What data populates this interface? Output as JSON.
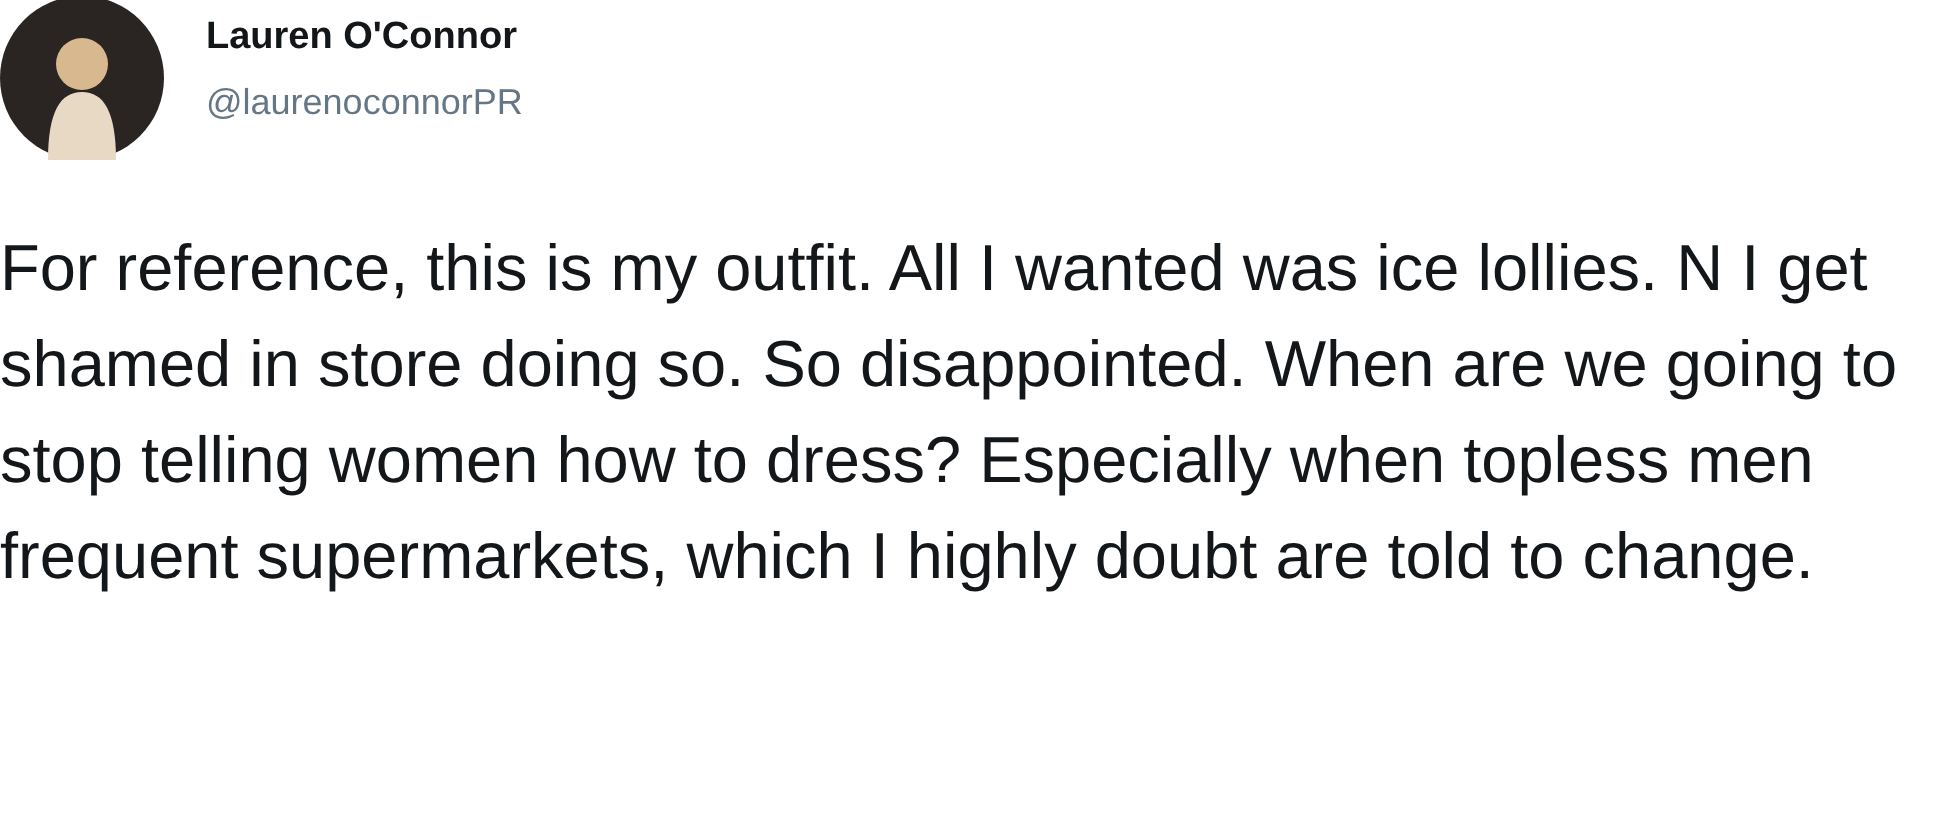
{
  "author": {
    "name": "Lauren O'Connor",
    "handle": "@laurenoconnorPR"
  },
  "tweet": {
    "text": "For reference, this is my outfit. All I wanted was ice lollies. N I get shamed in store doing so. So disappointed. When are we going to stop telling women how to dress? Especially when topless men frequent supermarkets, which I highly doubt are told to change."
  }
}
